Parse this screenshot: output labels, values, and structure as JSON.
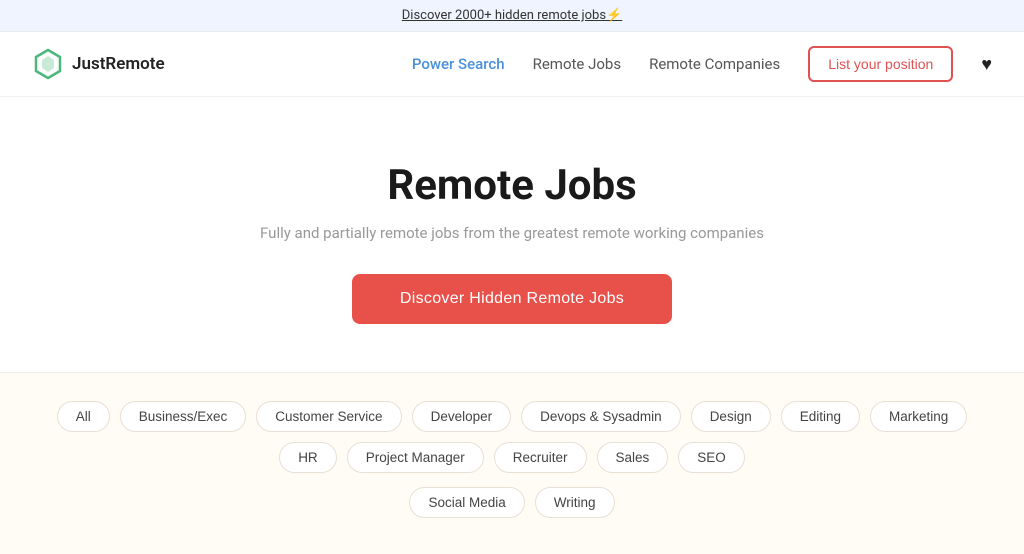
{
  "banner": {
    "text": "Discover 2000+ hidden remote jobs⚡"
  },
  "header": {
    "logo_text": "JustRemote",
    "nav": {
      "power_search": "Power Search",
      "remote_jobs": "Remote Jobs",
      "remote_companies": "Remote Companies",
      "list_position": "List your position"
    }
  },
  "hero": {
    "title": "Remote Jobs",
    "subtitle": "Fully and partially remote jobs from the greatest remote working companies",
    "cta_button": "Discover Hidden Remote Jobs"
  },
  "categories": {
    "row1": [
      "All",
      "Business/Exec",
      "Customer Service",
      "Developer",
      "Devops & Sysadmin",
      "Design",
      "Editing",
      "Marketing",
      "HR",
      "Project Manager",
      "Recruiter",
      "Sales",
      "SEO"
    ],
    "row2": [
      "Social Media",
      "Writing"
    ]
  }
}
